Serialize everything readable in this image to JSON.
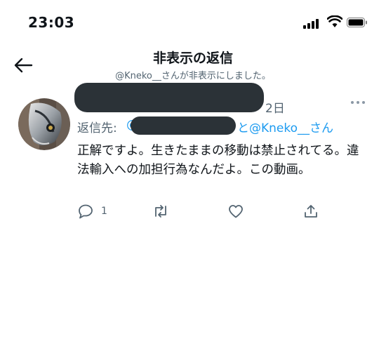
{
  "status_bar": {
    "time": "23:03"
  },
  "header": {
    "title": "非表示の返信",
    "subtitle": "@Kneko__さんが非表示にしました。"
  },
  "tweet": {
    "date_tail": "2日",
    "reply_prefix": "返信先:",
    "reply_at_left": "@",
    "reply_tail": "と@Kneko__さん",
    "text": "正解ですよ。生きたままの移動は禁止されてる。違法輸入への加担行為なんだよ。この動画。",
    "reply_count": "1"
  },
  "colors": {
    "accent": "#1d9bf0",
    "secondary_text": "#536471",
    "redaction": "#2b3237"
  },
  "icons": {
    "back": "arrow-left-icon",
    "more": "more-horizontal-icon",
    "reply": "reply-bubble-icon",
    "retweet": "retweet-icon",
    "like": "heart-icon",
    "share": "share-upload-icon"
  }
}
